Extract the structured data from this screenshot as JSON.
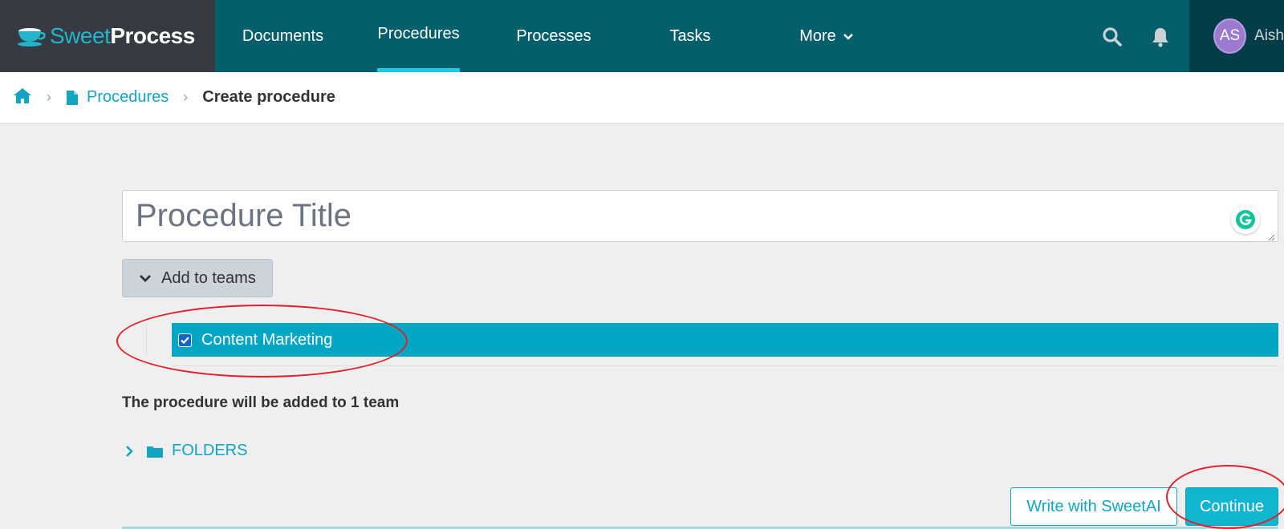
{
  "header": {
    "logo": {
      "part1": "Sweet",
      "part2": "Process"
    },
    "nav": [
      {
        "label": "Documents"
      },
      {
        "label": "Procedures",
        "active": true
      },
      {
        "label": "Processes"
      },
      {
        "label": "Tasks"
      },
      {
        "label": "More"
      }
    ],
    "user": {
      "initials": "AS",
      "name": "Aish"
    },
    "icons": {
      "search": "search-icon",
      "notifications": "bell-icon",
      "more_dropdown": "chevron-down-icon"
    }
  },
  "breadcrumb": {
    "home_icon": "home-icon",
    "items": [
      {
        "label": "Procedures",
        "icon": "document-icon"
      },
      {
        "label": "Create procedure"
      }
    ]
  },
  "form": {
    "title_placeholder": "Procedure Title",
    "title_value": "",
    "teams_button_label": "Add to teams",
    "teams": [
      {
        "name": "Content Marketing",
        "checked": true
      }
    ],
    "teams_summary": "The procedure will be added to 1 team",
    "folders_label": "FOLDERS"
  },
  "actions": {
    "write_ai_label": "Write with SweetAI",
    "continue_label": "Continue"
  },
  "colors": {
    "nav_bg": "#045e6c",
    "logo_bg": "#363a42",
    "accent": "#12a5c2",
    "team_row": "#00a6c2",
    "annotation": "#e41e26"
  }
}
